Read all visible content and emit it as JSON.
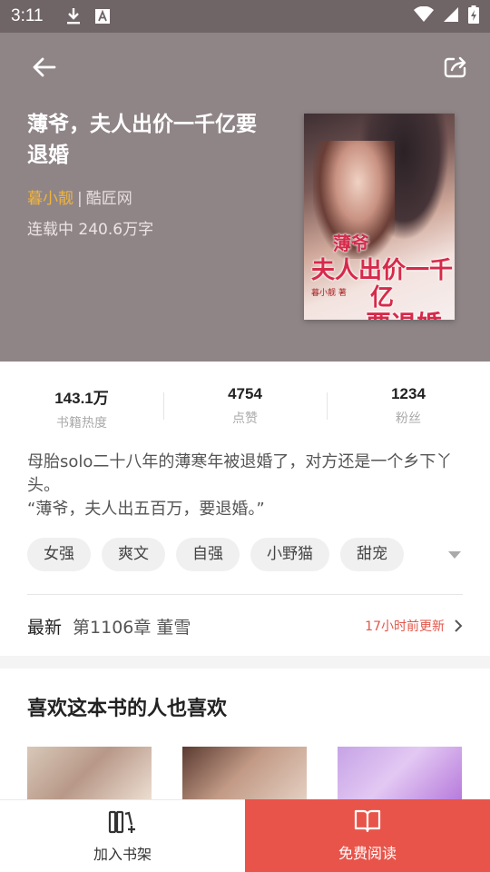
{
  "status_bar": {
    "time": "3:11",
    "icons": [
      "download-icon",
      "a-icon",
      "wifi-icon",
      "signal-icon",
      "battery-charging-icon"
    ]
  },
  "header": {
    "back_icon": "arrow-left-icon",
    "share_icon": "share-icon",
    "title": "薄爷，夫人出价一千亿要退婚",
    "author": "暮小靓",
    "separator": "|",
    "publisher": "酷匠网",
    "status": "连载中 240.6万字",
    "cover": {
      "title_line1": "薄爷",
      "title_line2": "夫人出价一千亿",
      "title_line3": "要退婚",
      "author": "暮小靓 著"
    }
  },
  "stats": [
    {
      "value": "143.1万",
      "label": "书籍热度"
    },
    {
      "value": "4754",
      "label": "点赞"
    },
    {
      "value": "1234",
      "label": "粉丝"
    }
  ],
  "description": {
    "line1": "母胎solo二十八年的薄寒年被退婚了，对方还是一个乡下丫头。",
    "line2": "“薄爷，夫人出五百万，要退婚。”"
  },
  "tags": [
    "女强",
    "爽文",
    "自强",
    "小野猫",
    "甜宠"
  ],
  "latest": {
    "label": "最新",
    "chapter": "第1106章 董雪",
    "time": "17小时前更新"
  },
  "recommend": {
    "title": "喜欢这本书的人也喜欢"
  },
  "bottom_bar": {
    "add_shelf": "加入书架",
    "free_read": "免费阅读"
  },
  "colors": {
    "header_bg": "#8f8587",
    "accent_red": "#e8544a",
    "author_gold": "#f0b43c"
  }
}
